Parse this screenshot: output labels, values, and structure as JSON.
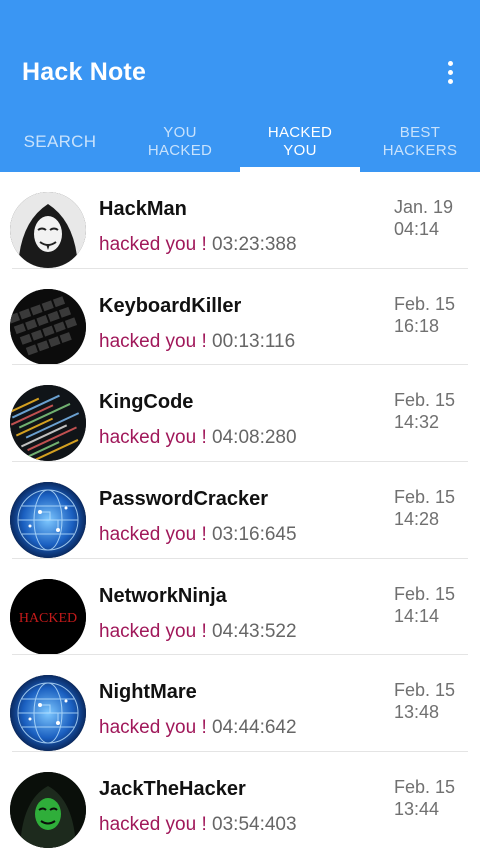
{
  "app": {
    "title": "Hack Note"
  },
  "tabs": [
    {
      "line1": "SEARCH",
      "line2": ""
    },
    {
      "line1": "YOU",
      "line2": "HACKED"
    },
    {
      "line1": "HACKED",
      "line2": "YOU"
    },
    {
      "line1": "BEST",
      "line2": "HACKERS"
    }
  ],
  "active_tab": 2,
  "colors": {
    "appbar": "#3a96f3",
    "hacked_label": "#a0185a"
  },
  "entries": [
    {
      "name": "HackMan",
      "label": "hacked you !",
      "time": "03:23:388",
      "date": "Jan. 19",
      "clock": "04:14",
      "avatar": "anonymous-hood-avatar"
    },
    {
      "name": "KeyboardKiller",
      "label": "hacked you !",
      "time": "00:13:116",
      "date": "Feb. 15",
      "clock": "16:18",
      "avatar": "keyboard-avatar"
    },
    {
      "name": "KingCode",
      "label": "hacked you !",
      "time": "04:08:280",
      "date": "Feb. 15",
      "clock": "14:32",
      "avatar": "code-screen-avatar"
    },
    {
      "name": "PasswordCracker",
      "label": "hacked you !",
      "time": "03:16:645",
      "date": "Feb. 15",
      "clock": "14:28",
      "avatar": "blue-globe-avatar"
    },
    {
      "name": "NetworkNinja",
      "label": "hacked you !",
      "time": "04:43:522",
      "date": "Feb. 15",
      "clock": "14:14",
      "avatar": "hacked-text-avatar",
      "avatar_text": "HACKED"
    },
    {
      "name": "NightMare",
      "label": "hacked you !",
      "time": "04:44:642",
      "date": "Feb. 15",
      "clock": "13:48",
      "avatar": "blue-globe-avatar"
    },
    {
      "name": "JackTheHacker",
      "label": "hacked you !",
      "time": "03:54:403",
      "date": "Feb. 15",
      "clock": "13:44",
      "avatar": "green-mask-avatar"
    }
  ]
}
